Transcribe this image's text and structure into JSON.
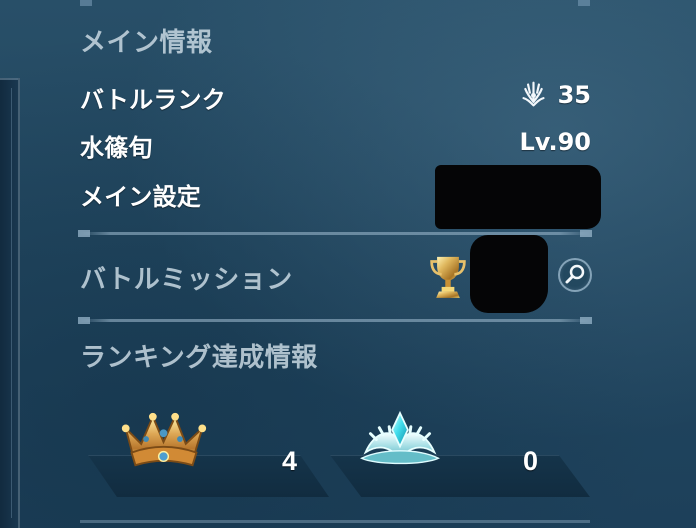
{
  "main_info": {
    "title": "メイン情報",
    "battle_rank": {
      "label": "バトルランク",
      "value": "35",
      "icon": "battle-rank-icon"
    },
    "character": {
      "label": "水篠旬",
      "value": "Lv.90"
    },
    "main_setting": {
      "label": "メイン設定",
      "value_state": "redacted"
    }
  },
  "battle_mission": {
    "label": "バトルミッション",
    "trophy_icon": "trophy-icon",
    "value_state": "redacted",
    "search_icon": "search-icon"
  },
  "ranking_achievement": {
    "title": "ランキング達成情報",
    "items": [
      {
        "icon": "gold-crown-icon",
        "count": "4"
      },
      {
        "icon": "silver-crown-icon",
        "count": "0"
      }
    ]
  },
  "colors": {
    "background": "#234a62",
    "text_primary": "#ffffff",
    "text_muted": "#cbdae4",
    "gold": "#d9a94f",
    "crystal": "#5ee7ef",
    "redaction": "#050506"
  }
}
